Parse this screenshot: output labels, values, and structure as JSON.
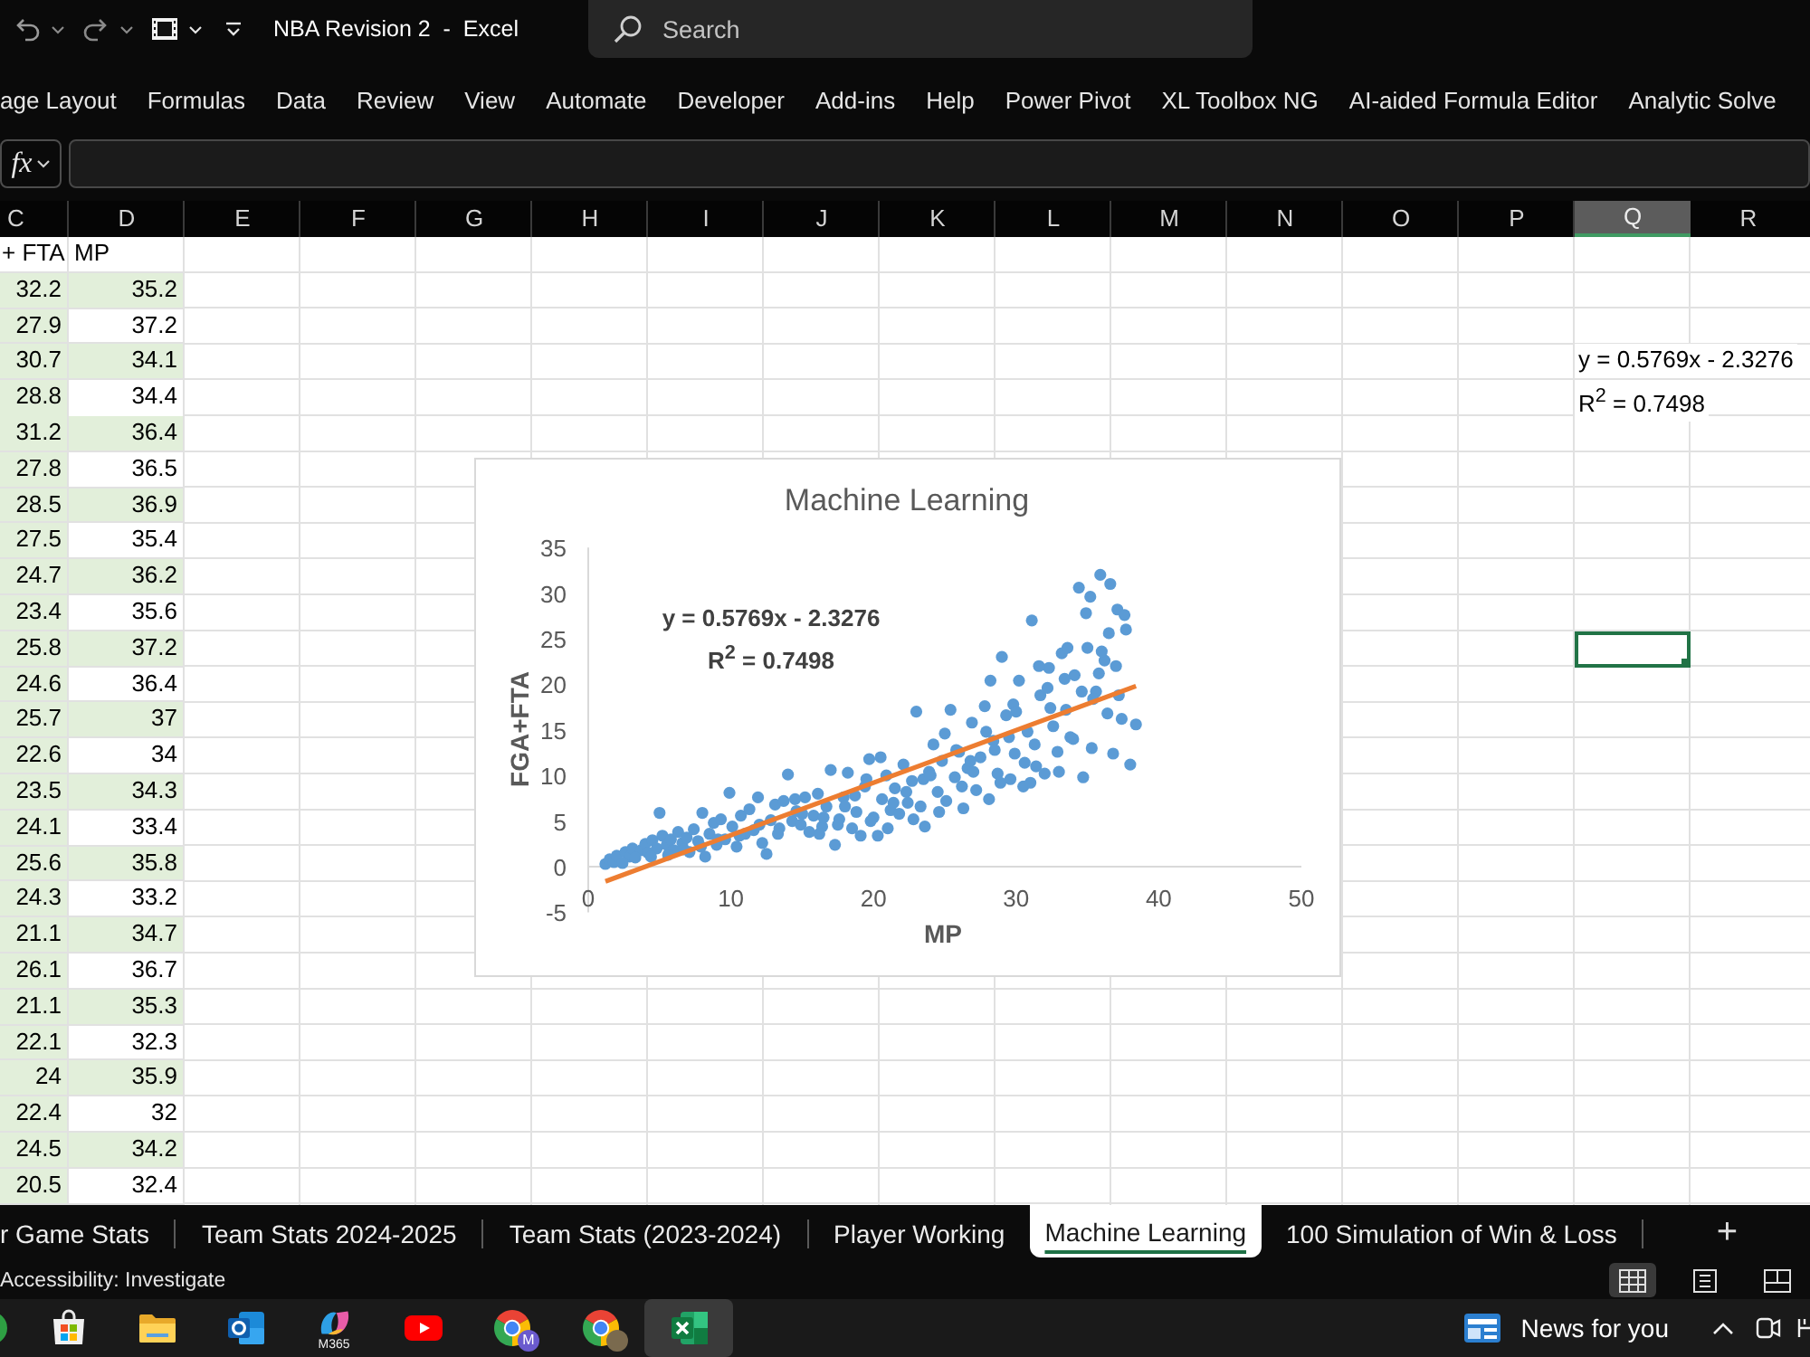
{
  "title_bar": {
    "title": "NBA Revision 2  -  Excel",
    "search": {
      "placeholder": "Search"
    }
  },
  "ribbon_tabs": [
    {
      "label": "age Layout"
    },
    {
      "label": "Formulas"
    },
    {
      "label": "Data"
    },
    {
      "label": "Review"
    },
    {
      "label": "View"
    },
    {
      "label": "Automate"
    },
    {
      "label": "Developer"
    },
    {
      "label": "Add-ins"
    },
    {
      "label": "Help"
    },
    {
      "label": "Power Pivot"
    },
    {
      "label": "XL Toolbox NG"
    },
    {
      "label": "AI-aided Formula Editor"
    },
    {
      "label": "Analytic Solve"
    }
  ],
  "formula_bar": {
    "function_label": "fx"
  },
  "sheet": {
    "columns": [
      {
        "letter": "C",
        "selected": false
      },
      {
        "letter": "D",
        "selected": false
      },
      {
        "letter": "E",
        "selected": false
      },
      {
        "letter": "F",
        "selected": false
      },
      {
        "letter": "G",
        "selected": false
      },
      {
        "letter": "H",
        "selected": false
      },
      {
        "letter": "I",
        "selected": false
      },
      {
        "letter": "J",
        "selected": false
      },
      {
        "letter": "K",
        "selected": false
      },
      {
        "letter": "L",
        "selected": false
      },
      {
        "letter": "M",
        "selected": false
      },
      {
        "letter": "N",
        "selected": false
      },
      {
        "letter": "O",
        "selected": false
      },
      {
        "letter": "P",
        "selected": false
      },
      {
        "letter": "Q",
        "selected": true
      },
      {
        "letter": "R",
        "selected": false
      }
    ],
    "header_row": {
      "column_c": {
        "value": "+ FTA",
        "highlighted": false,
        "selected": false
      },
      "column_d": {
        "value": "MP",
        "highlighted": false,
        "selected": false
      }
    },
    "rows": [
      {
        "column_c": {
          "value": "32.2",
          "highlighted": true,
          "selected": false
        },
        "column_d": {
          "value": "35.2",
          "highlighted": true,
          "selected": false
        }
      },
      {
        "column_c": {
          "value": "27.9",
          "highlighted": true,
          "selected": false
        },
        "column_d": {
          "value": "37.2",
          "highlighted": false,
          "selected": false
        }
      },
      {
        "column_c": {
          "value": "30.7",
          "highlighted": true,
          "selected": false
        },
        "column_d": {
          "value": "34.1",
          "highlighted": true,
          "selected": false
        },
        "column_q": {
          "value": "y = 0.5769x - 2.3276",
          "selected": false
        }
      },
      {
        "column_c": {
          "value": "28.8",
          "highlighted": true,
          "selected": false
        },
        "column_d": {
          "value": "34.4",
          "highlighted": false,
          "selected": false
        },
        "column_q": {
          "value": "R$^{2}$ = 0.7498",
          "selected": false
        }
      },
      {
        "column_c": {
          "value": "31.2",
          "highlighted": true,
          "selected": false
        },
        "column_d": {
          "value": "36.4",
          "highlighted": true,
          "selected": false
        }
      },
      {
        "column_c": {
          "value": "27.8",
          "highlighted": true,
          "selected": false
        },
        "column_d": {
          "value": "36.5",
          "highlighted": false,
          "selected": false
        }
      },
      {
        "column_c": {
          "value": "28.5",
          "highlighted": true,
          "selected": false
        },
        "column_d": {
          "value": "36.9",
          "highlighted": true,
          "selected": false
        }
      },
      {
        "column_c": {
          "value": "27.5",
          "highlighted": true,
          "selected": false
        },
        "column_d": {
          "value": "35.4",
          "highlighted": false,
          "selected": false
        }
      },
      {
        "column_c": {
          "value": "24.7",
          "highlighted": true,
          "selected": false
        },
        "column_d": {
          "value": "36.2",
          "highlighted": true,
          "selected": false
        }
      },
      {
        "column_c": {
          "value": "23.4",
          "highlighted": true,
          "selected": false
        },
        "column_d": {
          "value": "35.6",
          "highlighted": false,
          "selected": false
        }
      },
      {
        "column_c": {
          "value": "25.8",
          "highlighted": true,
          "selected": false
        },
        "column_d": {
          "value": "37.2",
          "highlighted": true,
          "selected": false
        },
        "column_q": {
          "selected": true
        }
      },
      {
        "column_c": {
          "value": "24.6",
          "highlighted": true,
          "selected": false
        },
        "column_d": {
          "value": "36.4",
          "highlighted": false,
          "selected": false
        }
      },
      {
        "column_c": {
          "value": "25.7",
          "highlighted": true,
          "selected": false
        },
        "column_d": {
          "value": "37",
          "highlighted": true,
          "selected": false
        }
      },
      {
        "column_c": {
          "value": "22.6",
          "highlighted": true,
          "selected": false
        },
        "column_d": {
          "value": "34",
          "highlighted": false,
          "selected": false
        }
      },
      {
        "column_c": {
          "value": "23.5",
          "highlighted": true,
          "selected": false
        },
        "column_d": {
          "value": "34.3",
          "highlighted": true,
          "selected": false
        }
      },
      {
        "column_c": {
          "value": "24.1",
          "highlighted": true,
          "selected": false
        },
        "column_d": {
          "value": "33.4",
          "highlighted": false,
          "selected": false
        }
      },
      {
        "column_c": {
          "value": "25.6",
          "highlighted": true,
          "selected": false
        },
        "column_d": {
          "value": "35.8",
          "highlighted": true,
          "selected": false
        }
      },
      {
        "column_c": {
          "value": "24.3",
          "highlighted": true,
          "selected": false
        },
        "column_d": {
          "value": "33.2",
          "highlighted": false,
          "selected": false
        }
      },
      {
        "column_c": {
          "value": "21.1",
          "highlighted": true,
          "selected": false
        },
        "column_d": {
          "value": "34.7",
          "highlighted": true,
          "selected": false
        }
      },
      {
        "column_c": {
          "value": "26.1",
          "highlighted": true,
          "selected": false
        },
        "column_d": {
          "value": "36.7",
          "highlighted": false,
          "selected": false
        }
      },
      {
        "column_c": {
          "value": "21.1",
          "highlighted": true,
          "selected": false
        },
        "column_d": {
          "value": "35.3",
          "highlighted": true,
          "selected": false
        }
      },
      {
        "column_c": {
          "value": "22.1",
          "highlighted": true,
          "selected": false
        },
        "column_d": {
          "value": "32.3",
          "highlighted": false,
          "selected": false
        }
      },
      {
        "column_c": {
          "value": "24",
          "highlighted": true,
          "selected": false
        },
        "column_d": {
          "value": "35.9",
          "highlighted": true,
          "selected": false
        }
      },
      {
        "column_c": {
          "value": "22.4",
          "highlighted": true,
          "selected": false
        },
        "column_d": {
          "value": "32",
          "highlighted": false,
          "selected": false
        }
      },
      {
        "column_c": {
          "value": "24.5",
          "highlighted": true,
          "selected": false
        },
        "column_d": {
          "value": "34.2",
          "highlighted": true,
          "selected": false
        }
      },
      {
        "column_c": {
          "value": "20.5",
          "highlighted": true,
          "selected": false
        },
        "column_d": {
          "value": "32.4",
          "highlighted": false,
          "selected": false
        }
      }
    ]
  },
  "chart": {
    "chart_data": {
      "type": "scatter",
      "title": "Machine Learning",
      "xlabel": "MP",
      "ylabel": "FGA+FTA",
      "xlim": [
        0,
        50
      ],
      "ylim": [
        -5,
        35
      ],
      "xticks": [
        0,
        10,
        20,
        30,
        40,
        50
      ],
      "yticks": [
        -5,
        0,
        5,
        10,
        15,
        20,
        25,
        30,
        35
      ],
      "series": [
        {
          "type": "scatter",
          "color": "#5b9bd5",
          "x": [
            1.2,
            1.5,
            1.8,
            2.0,
            2.6,
            2.9,
            3.1,
            3.7,
            4.0,
            4.2,
            4.5,
            4.8,
            5.0,
            5.2,
            5.5,
            5.8,
            6.0,
            6.3,
            6.6,
            6.9,
            7.1,
            7.4,
            7.7,
            8.0,
            8.2,
            8.5,
            8.8,
            9.0,
            9.3,
            9.6,
            9.9,
            10.1,
            10.4,
            10.7,
            11.0,
            11.3,
            11.6,
            11.9,
            12.2,
            12.5,
            12.8,
            13.1,
            13.4,
            13.7,
            14.0,
            14.3,
            14.6,
            14.9,
            15.2,
            15.5,
            15.8,
            16.1,
            16.4,
            16.7,
            17.0,
            17.3,
            17.6,
            17.9,
            18.2,
            18.5,
            18.8,
            19.1,
            19.4,
            19.7,
            20.0,
            20.3,
            20.6,
            20.9,
            21.2,
            21.5,
            21.8,
            22.1,
            22.4,
            22.7,
            23.0,
            23.3,
            23.6,
            23.9,
            24.2,
            24.5,
            24.8,
            25.1,
            25.4,
            25.7,
            26.0,
            26.3,
            26.6,
            26.9,
            27.2,
            27.5,
            27.8,
            28.1,
            28.4,
            28.7,
            29.0,
            29.3,
            29.6,
            29.9,
            30.2,
            30.5,
            30.8,
            31.1,
            31.4,
            31.7,
            32.0,
            32.3,
            32.6,
            32.9,
            33.2,
            33.5,
            33.8,
            34.1,
            34.4,
            34.7,
            35.0,
            35.3,
            35.6,
            35.9,
            36.2,
            36.5,
            36.8,
            37.1,
            37.4,
            37.7,
            38.0,
            38.4,
            2.4,
            3.3,
            4.4,
            5.6,
            6.7,
            7.9,
            9.1,
            10.6,
            12.0,
            13.3,
            15.0,
            16.2,
            17.5,
            18.7,
            19.8,
            21.0,
            22.3,
            23.5,
            24.6,
            25.8,
            26.8,
            27.9,
            28.9,
            29.8,
            30.6,
            31.6,
            32.4,
            33.4,
            34.0,
            34.9,
            35.4,
            36.0,
            36.6,
            37.0,
            37.6,
            31.0,
            28.2,
            33.0,
            35.2,
            36.4,
            14.5,
            16.5,
            18.0,
            19.5,
            20.5,
            21.4,
            22.8,
            24.0,
            25.0,
            26.2,
            27.0,
            28.5,
            29.5,
            30.0,
            31.3,
            32.2,
            33.6,
            34.6,
            35.8,
            37.2
          ],
          "values": [
            0.3,
            0.8,
            0.5,
            1.2,
            1.6,
            1.1,
            2.0,
            1.8,
            2.5,
            1.5,
            2.9,
            2.0,
            5.9,
            3.4,
            2.4,
            3.0,
            1.8,
            3.8,
            2.6,
            3.2,
            1.6,
            4.1,
            2.8,
            5.9,
            1.1,
            3.6,
            4.8,
            2.4,
            5.2,
            3.0,
            8.1,
            4.4,
            2.2,
            5.6,
            3.6,
            6.3,
            4.0,
            7.6,
            2.6,
            1.4,
            5.1,
            6.8,
            4.2,
            7.2,
            10.1,
            5.0,
            6.1,
            4.6,
            7.6,
            3.8,
            5.6,
            8.0,
            4.4,
            6.6,
            10.6,
            2.4,
            5.2,
            7.6,
            10.3,
            4.2,
            6.0,
            3.4,
            8.8,
            11.8,
            5.4,
            3.4,
            7.4,
            10.0,
            6.2,
            8.6,
            5.8,
            11.2,
            7.0,
            9.4,
            17.0,
            6.6,
            4.4,
            10.4,
            13.4,
            8.2,
            11.6,
            7.2,
            17.2,
            9.8,
            12.6,
            6.4,
            10.8,
            15.8,
            8.4,
            12.0,
            17.6,
            7.4,
            13.8,
            10.2,
            23.0,
            16.6,
            9.6,
            12.4,
            20.4,
            8.8,
            14.8,
            27.0,
            11.0,
            18.8,
            10.2,
            21.8,
            15.4,
            12.6,
            23.4,
            17.2,
            14.2,
            21.0,
            30.6,
            9.8,
            24.0,
            13.0,
            19.2,
            32.0,
            22.6,
            25.6,
            12.4,
            28.2,
            16.2,
            26.0,
            11.2,
            15.6,
            0.4,
            1.0,
            1.1,
            1.3,
            1.9,
            2.2,
            3.0,
            3.4,
            4.6,
            3.6,
            5.8,
            3.6,
            4.6,
            7.8,
            5.0,
            4.2,
            8.2,
            9.6,
            6.0,
            12.8,
            11.6,
            14.8,
            9.2,
            17.8,
            11.4,
            22.0,
            17.4,
            20.6,
            14.0,
            27.8,
            18.4,
            23.6,
            31.0,
            22.0,
            27.6,
            9.2,
            20.4,
            10.4,
            29.6,
            16.8,
            7.4,
            5.4,
            6.6,
            9.6,
            12.0,
            7.0,
            5.2,
            10.0,
            14.6,
            8.8,
            10.4,
            12.8,
            14.2,
            17.0,
            13.4,
            19.6,
            24.0,
            19.2,
            21.2,
            18.8
          ]
        },
        {
          "type": "line",
          "color": "#ed7d31",
          "x": [
            1.2,
            38.4
          ],
          "values": [
            -1.6,
            19.8
          ]
        }
      ],
      "annotations": [
        {
          "text": "y = 0.5769x - 2.3276"
        },
        {
          "text": "R$^{2}$ = 0.7498"
        }
      ]
    }
  },
  "sheet_tabs": [
    {
      "label": "r Game Stats",
      "selected": false
    },
    {
      "label": "Team Stats 2024-2025",
      "selected": false
    },
    {
      "label": "Team Stats (2023-2024)",
      "selected": false
    },
    {
      "label": "Player Working",
      "selected": false
    },
    {
      "label": "Machine Learning",
      "selected": true
    },
    {
      "label": "100 Simulation of Win & Loss",
      "selected": false
    }
  ],
  "add_sheet_button": {
    "label": "+"
  },
  "status_bar": {
    "text": "Accessibility: Investigate",
    "view_buttons": [
      {
        "kind": "normal",
        "selected": true
      },
      {
        "kind": "page-layout",
        "selected": false
      },
      {
        "kind": "page-break",
        "selected": false
      }
    ]
  },
  "taskbar": {
    "apps": [
      {
        "kind": "app",
        "selected": false
      },
      {
        "kind": "store",
        "selected": false
      },
      {
        "kind": "folder",
        "selected": false
      },
      {
        "kind": "mail",
        "selected": false
      },
      {
        "kind": "swirl",
        "badge": "M365",
        "selected": false
      },
      {
        "kind": "video",
        "selected": false
      },
      {
        "kind": "browser",
        "badge": "M",
        "selected": false
      },
      {
        "kind": "browser-avatar",
        "selected": false
      },
      {
        "kind": "spreadsheet",
        "selected": true
      }
    ],
    "news": {
      "label": "News for you"
    }
  }
}
